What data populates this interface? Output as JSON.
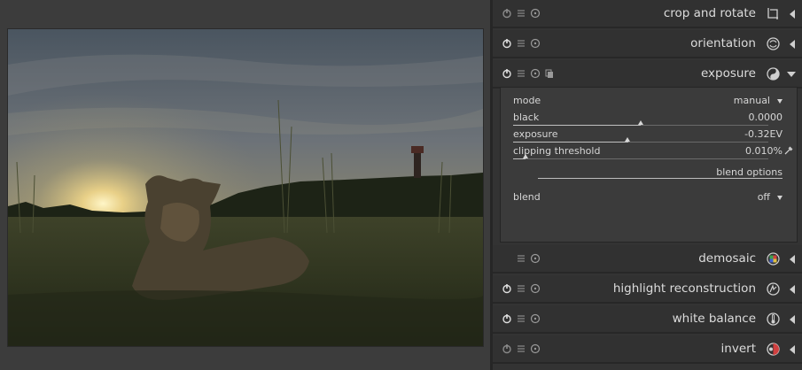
{
  "photo": {
    "description_icon": "photo-icon"
  },
  "modules": [
    {
      "key": "crop",
      "label": "crop and rotate",
      "enabled": false,
      "icon": "crop-icon",
      "expanded": false
    },
    {
      "key": "orientation",
      "label": "orientation",
      "enabled": true,
      "icon": "orientation-icon",
      "expanded": false
    },
    {
      "key": "exposure",
      "label": "exposure",
      "enabled": true,
      "icon": "exposure-icon",
      "expanded": true
    },
    {
      "key": "demosaic",
      "label": "demosaic",
      "enabled": null,
      "icon": "demosaic-icon",
      "expanded": false
    },
    {
      "key": "highlight",
      "label": "highlight reconstruction",
      "enabled": true,
      "icon": "highlight-icon",
      "expanded": false
    },
    {
      "key": "whitebalance",
      "label": "white balance",
      "enabled": true,
      "icon": "white-balance-icon",
      "expanded": false
    },
    {
      "key": "invert",
      "label": "invert",
      "enabled": false,
      "icon": "invert-icon",
      "expanded": false
    }
  ],
  "exposure_panel": {
    "mode_label": "mode",
    "mode_value": "manual",
    "black_label": "black",
    "black_value": "0.0000",
    "black_level": 0.5,
    "exposure_label": "exposure",
    "exposure_value": "-0.32EV",
    "exposure_level": 0.45,
    "clipping_label": "clipping threshold",
    "clipping_value": "0.010%",
    "clipping_level": 0.05,
    "blend_options_label": "blend options",
    "blend_label": "blend",
    "blend_value": "off"
  },
  "colors": {
    "panel_bg": "#313131",
    "accent_line": "#bdbdbd"
  }
}
